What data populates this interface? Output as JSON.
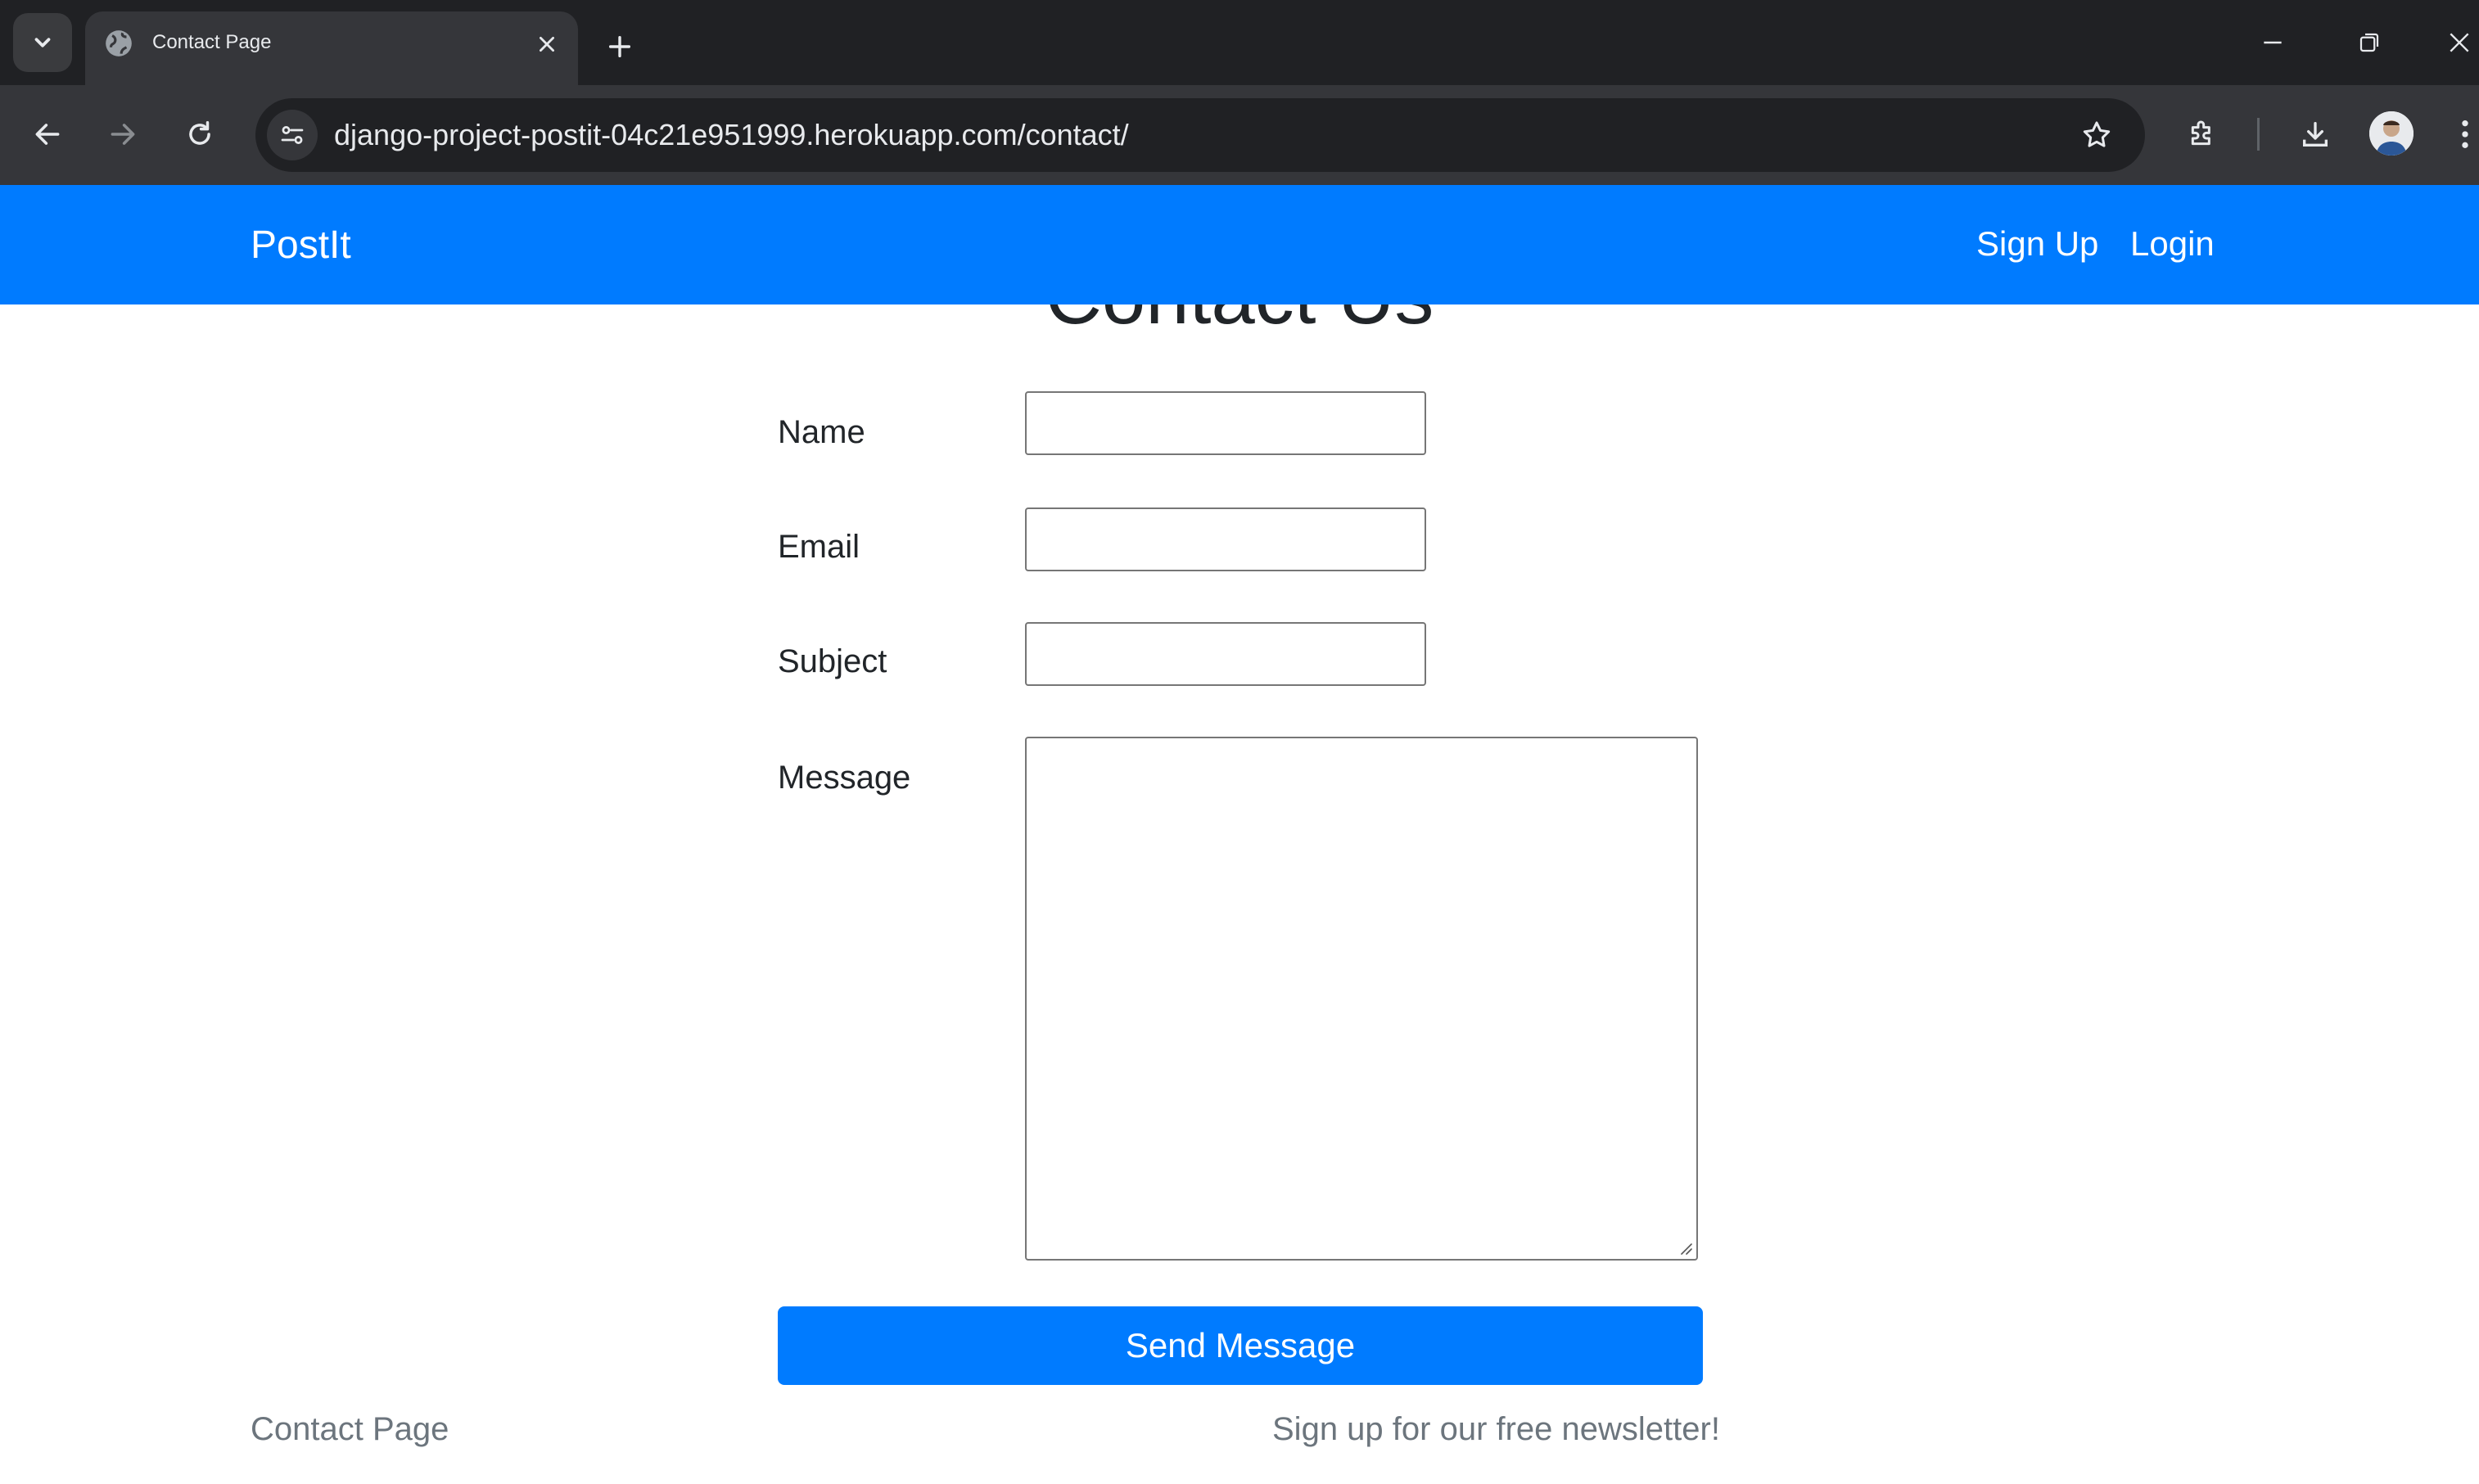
{
  "browser": {
    "tab_title": "Contact Page",
    "url_host": "django-project-postit-04c21e951999.herokuapp.com",
    "url_path": "/contact/"
  },
  "site": {
    "brand": "PostIt",
    "nav": {
      "signup": "Sign Up",
      "login": "Login"
    }
  },
  "page": {
    "heading": "Contact Us",
    "form": {
      "name_label": "Name",
      "name_value": "",
      "email_label": "Email",
      "email_value": "",
      "subject_label": "Subject",
      "subject_value": "",
      "message_label": "Message",
      "message_value": "",
      "submit": "Send Message"
    },
    "footer": {
      "left": "Contact Page",
      "right": "Sign up for our free newsletter!"
    }
  },
  "colors": {
    "brand_blue": "#007bff",
    "chrome_dark": "#202124",
    "chrome_mid": "#35363a"
  }
}
